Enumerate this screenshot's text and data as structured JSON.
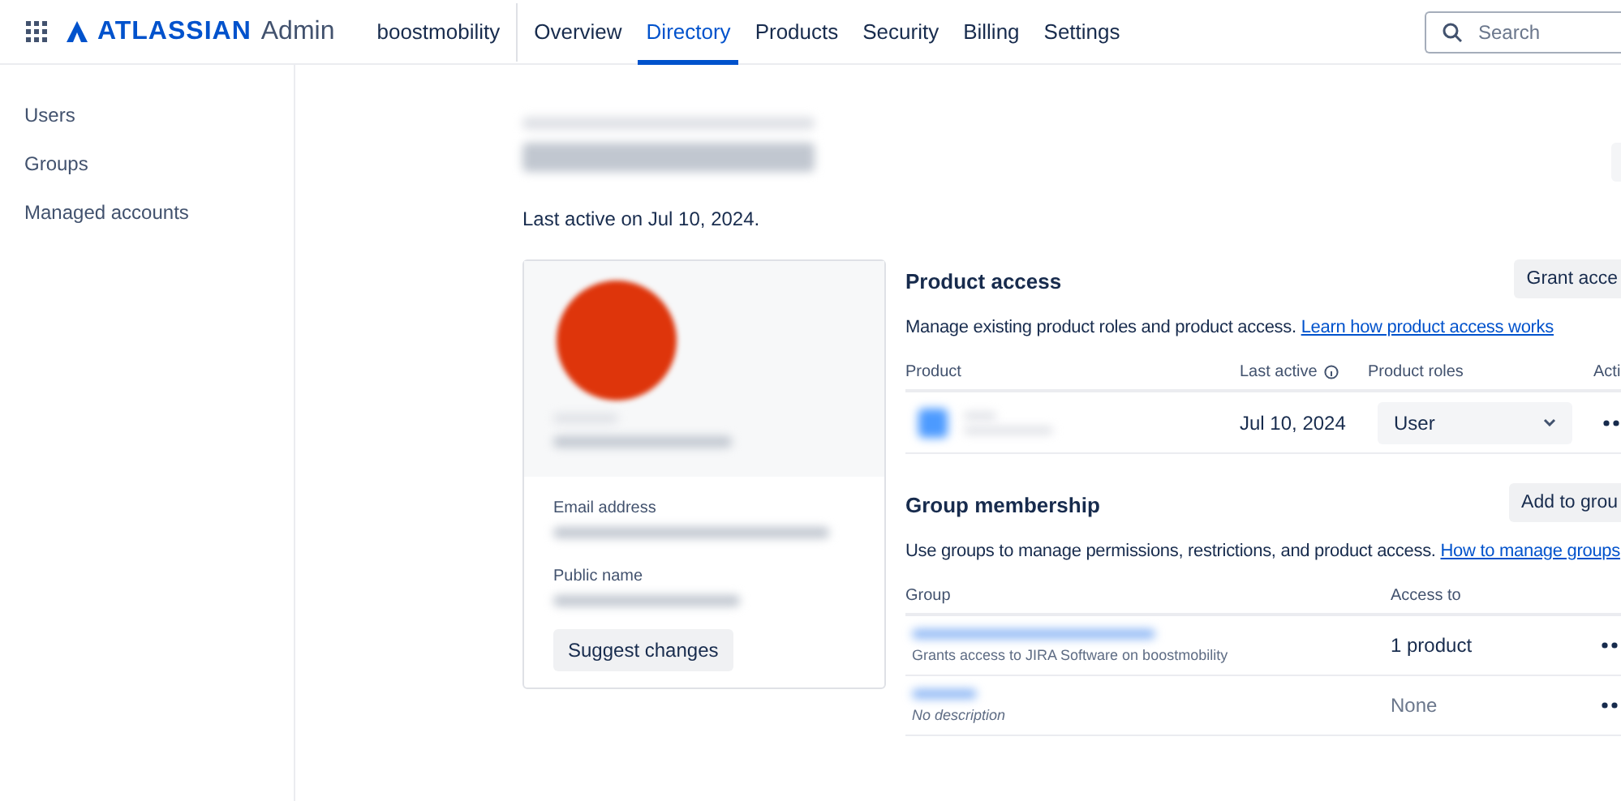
{
  "header": {
    "brand": "ATLASSIAN",
    "product": "Admin",
    "org": "boostmobility",
    "nav": [
      {
        "label": "Overview",
        "selected": false
      },
      {
        "label": "Directory",
        "selected": true
      },
      {
        "label": "Products",
        "selected": false
      },
      {
        "label": "Security",
        "selected": false
      },
      {
        "label": "Billing",
        "selected": false
      },
      {
        "label": "Settings",
        "selected": false
      }
    ],
    "search": {
      "placeholder": "Search"
    }
  },
  "sidebar": {
    "items": [
      {
        "label": "Users"
      },
      {
        "label": "Groups"
      },
      {
        "label": "Managed accounts"
      }
    ]
  },
  "last_active": "Last active on Jul 10, 2024.",
  "profile": {
    "fields": [
      {
        "label": "Email address"
      },
      {
        "label": "Public name"
      }
    ],
    "button": "Suggest changes"
  },
  "product_access": {
    "title": "Product access",
    "button": "Grant acce",
    "description": "Manage existing product roles and product access. ",
    "link": "Learn how product access works",
    "columns": [
      "Product",
      "Last active",
      "Product roles",
      "Acti"
    ],
    "rows": [
      {
        "last_active": "Jul 10, 2024",
        "role": "User"
      }
    ]
  },
  "groups": {
    "title": "Group membership",
    "button": "Add to grou",
    "description": "Use groups to manage permissions, restrictions, and product access. ",
    "link": "How to manage groups",
    "columns": [
      "Group",
      "Access to"
    ],
    "rows": [
      {
        "description": "Grants access to JIRA Software on boostmobility",
        "access": "1 product",
        "has_description": true
      },
      {
        "description": "No description",
        "access": "None",
        "has_description": false
      }
    ]
  }
}
